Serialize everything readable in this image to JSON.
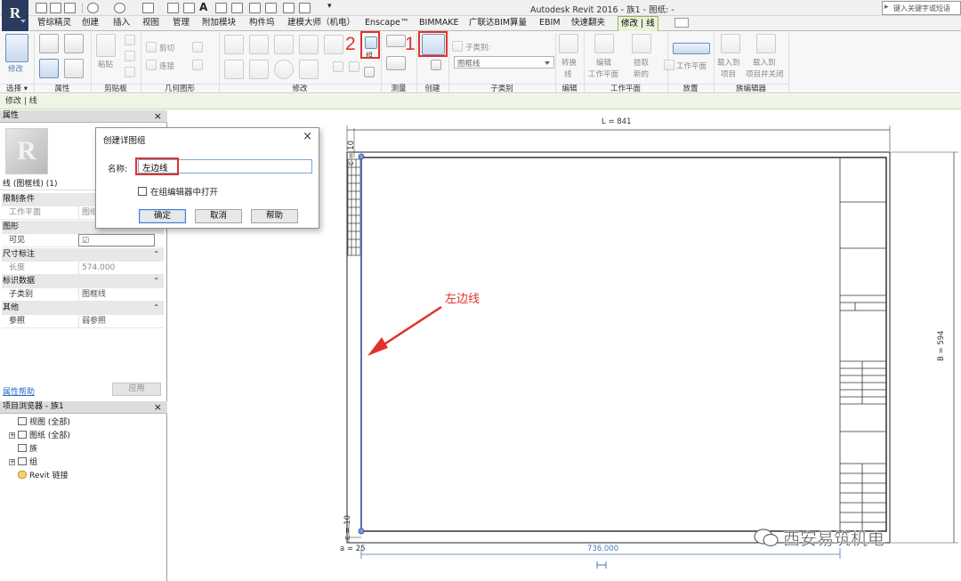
{
  "app": {
    "logo_letter": "R",
    "title": "Autodesk Revit 2016 -   族1 - 图纸: -",
    "search_placeholder": "键入关键字或短语"
  },
  "tabs": [
    {
      "label": "管综精灵",
      "active": false
    },
    {
      "label": "创建",
      "active": false
    },
    {
      "label": "插入",
      "active": false
    },
    {
      "label": "视图",
      "active": false
    },
    {
      "label": "管理",
      "active": false
    },
    {
      "label": "附加模块",
      "active": false
    },
    {
      "label": "构件坞",
      "active": false
    },
    {
      "label": "建模大师（机电）",
      "active": false
    },
    {
      "label": "Enscape™",
      "active": false
    },
    {
      "label": "BIMMAKE",
      "active": false
    },
    {
      "label": "广联达BIM算量",
      "active": false
    },
    {
      "label": "EBIM",
      "active": false
    },
    {
      "label": "快速翻夹",
      "active": false
    },
    {
      "label": "修改 | 线",
      "active": true
    }
  ],
  "ribbon": {
    "panels": [
      {
        "label": "选择 ▾"
      },
      {
        "label": "属性"
      },
      {
        "label": "剪贴板"
      },
      {
        "label": "几何图形"
      },
      {
        "label": "修改"
      },
      {
        "label": "测量"
      },
      {
        "label": "创建"
      },
      {
        "label": "子类别"
      },
      {
        "label": "编辑"
      },
      {
        "label": "工作平面"
      },
      {
        "label": "放置"
      },
      {
        "label": "族编辑器"
      }
    ],
    "modify_label": "修改",
    "paste_label": "粘贴",
    "cut_label": "剪切",
    "join_label": "连接",
    "subcategory_caption": "子类别:",
    "subcategory_value": "图框线",
    "edit_btn": [
      "转换",
      "线"
    ],
    "workplane_btn": [
      "编辑",
      "工作平面"
    ],
    "pick_new_btn": [
      "拾取",
      "新的"
    ],
    "placement_btn": "工作平面",
    "load_project_btn": [
      "载入到",
      "项目"
    ],
    "load_close_btn": [
      "载入到",
      "项目并关闭"
    ],
    "group_btn_text": "组",
    "step_marker_1": "1",
    "step_marker_2": "2"
  },
  "options_bar": {
    "text": "修改 | 线"
  },
  "properties": {
    "header": "属性",
    "close": "×",
    "type_selector": "线 (图框线) (1)",
    "groups": [
      {
        "label": "限制条件",
        "rows": [
          {
            "key": "工作平面",
            "value": "图纸"
          }
        ]
      },
      {
        "label": "图形",
        "rows": [
          {
            "key": "可见",
            "value": "☑"
          }
        ]
      },
      {
        "label": "尺寸标注",
        "rows": [
          {
            "key": "长度",
            "value": "574.000"
          }
        ]
      },
      {
        "label": "标识数据",
        "rows": [
          {
            "key": "子类别",
            "value": "图框线"
          }
        ]
      },
      {
        "label": "其他",
        "rows": [
          {
            "key": "参照",
            "value": "弱参照"
          }
        ]
      }
    ],
    "help_link": "属性帮助",
    "apply_button": "应用"
  },
  "project_browser": {
    "header": "项目浏览器 - 族1",
    "close": "×",
    "items": [
      {
        "label": "视图 (全部)",
        "expandable": false
      },
      {
        "label": "图纸 (全部)",
        "expandable": true
      },
      {
        "label": "族",
        "expandable": false
      },
      {
        "label": "组",
        "expandable": true
      },
      {
        "label": "Revit 链接",
        "expandable": false
      }
    ]
  },
  "dialog": {
    "title": "创建详图组",
    "close": "×",
    "name_label": "名称:",
    "name_value": "左边线",
    "checkbox_label": "在组编辑器中打开",
    "checkbox_checked": false,
    "buttons": {
      "ok": "确定",
      "cancel": "取消",
      "help": "帮助"
    }
  },
  "drawing": {
    "dim_L": "L = 841",
    "dim_B": "B = 594",
    "dim_c_top": "c = 10",
    "dim_c_bottom": "c = 10",
    "dim_a": "a = 25",
    "dim_temp": "736.000",
    "annotation": "左边线"
  },
  "watermark": "西安易筑机电",
  "colors": {
    "accent_red": "#e0322c",
    "active_tab_bg": "#eaf2d9",
    "selection_blue": "#4a73b8",
    "logo_bg": "#2a3b5e"
  }
}
